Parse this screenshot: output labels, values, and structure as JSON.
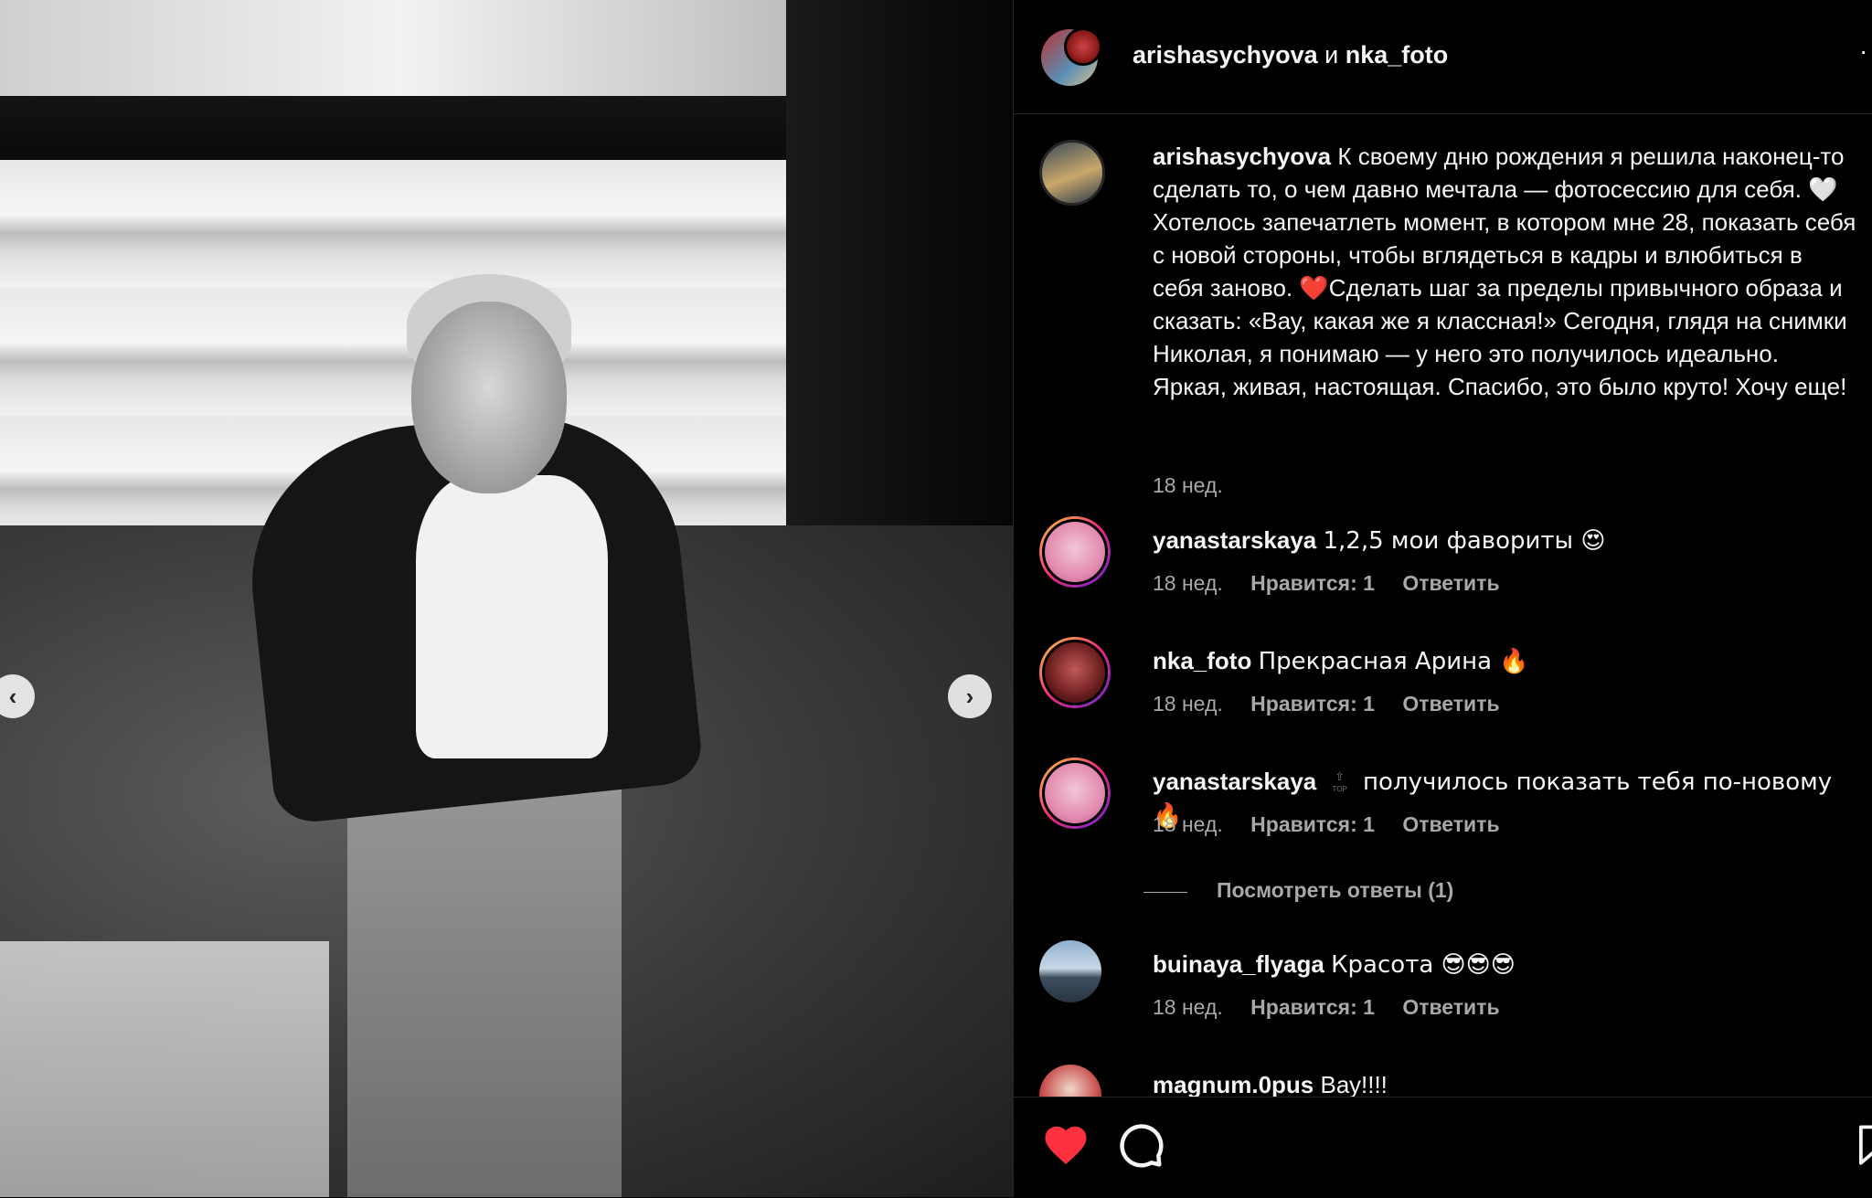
{
  "header": {
    "owner": "arishasychyova",
    "conjunction": "и",
    "collaborator": "nka_foto",
    "more_icon": "more-horizontal-icon"
  },
  "caption": {
    "username": "arishasychyova",
    "text": "К своему дню рождения я решила наконец-то сделать то, о чем давно мечтала — фотосессию для себя. 🤍Хотелось запечатлеть момент, в котором мне 28, показать себя с новой стороны, чтобы вглядеться в кадры и влюбиться в себя заново. ❤️Сделать шаг за пределы привычного образа и сказать: «Вау, какая же я классная!» Сегодня, глядя на снимки Николая, я понимаю — у него это получилось идеально. Яркая, живая, настоящая. Спасибо, это было круто! Хочу еще!",
    "time": "18 нед."
  },
  "comments": [
    {
      "username": "yanastarskaya",
      "text": "1,2,5 мои фавориты 😍",
      "time": "18 нед.",
      "likes": "Нравится: 1",
      "reply": "Ответить"
    },
    {
      "username": "nka_foto",
      "text": "Прекрасная Арина 🔥",
      "time": "18 нед.",
      "likes": "Нравится: 1",
      "reply": "Ответить"
    },
    {
      "username": "yanastarskaya",
      "badge": "TOP",
      "text": "получилось показать тебя по-новому 🔥",
      "time": "18 нед.",
      "likes": "Нравится: 1",
      "reply": "Ответить"
    },
    {
      "username": "buinaya_flyaga",
      "text": "Красота 😎😎😎",
      "time": "18 нед.",
      "likes": "Нравится: 1",
      "reply": "Ответить"
    },
    {
      "username": "magnum.0pus",
      "text": "Вау!!!!"
    }
  ],
  "view_replies": "Посмотреть ответы (1)",
  "actions": {
    "like_icon": "heart-filled-icon",
    "comment_icon": "comment-icon",
    "save_icon": "bookmark-icon",
    "like_color": "#ff3040"
  },
  "carousel": {
    "prev_icon": "chevron-left-icon",
    "next_icon": "chevron-right-icon"
  }
}
